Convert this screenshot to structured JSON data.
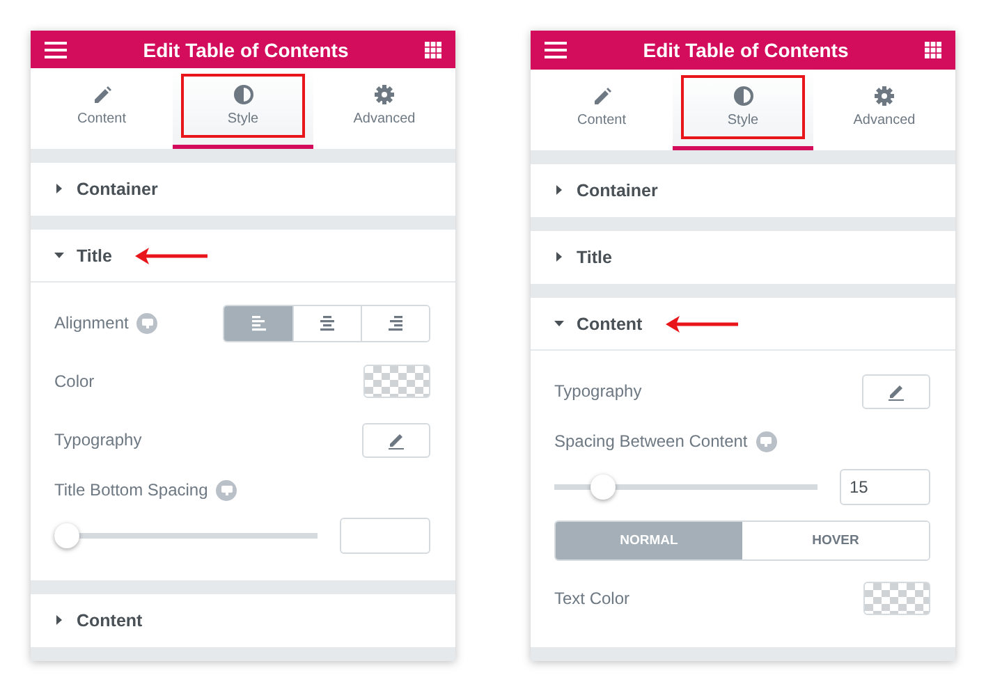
{
  "panels": [
    {
      "header": {
        "title": "Edit Table of Contents"
      },
      "tabs": [
        {
          "label": "Content",
          "selected": false,
          "highlighted": false
        },
        {
          "label": "Style",
          "selected": true,
          "highlighted": true
        },
        {
          "label": "Advanced",
          "selected": false,
          "highlighted": false
        }
      ],
      "sections": [
        {
          "title": "Container",
          "expanded": false,
          "pointed": false
        },
        {
          "title": "Title",
          "expanded": true,
          "pointed": true,
          "controls": [
            {
              "kind": "alignment",
              "label": "Alignment",
              "responsive": true,
              "options": [
                {
                  "selected": true
                },
                {
                  "selected": false
                },
                {
                  "selected": false
                }
              ]
            },
            {
              "kind": "color",
              "label": "Color"
            },
            {
              "kind": "typography",
              "label": "Typography"
            },
            {
              "kind": "slider",
              "label": "Title Bottom Spacing",
              "responsive": true,
              "level": 0
            }
          ]
        },
        {
          "title": "Content",
          "expanded": false,
          "pointed": false
        }
      ]
    },
    {
      "header": {
        "title": "Edit Table of Contents"
      },
      "tabs": [
        {
          "label": "Content",
          "selected": false,
          "highlighted": false
        },
        {
          "label": "Style",
          "selected": true,
          "highlighted": true
        },
        {
          "label": "Advanced",
          "selected": false,
          "highlighted": false
        }
      ],
      "sections": [
        {
          "title": "Container",
          "expanded": false,
          "pointed": false
        },
        {
          "title": "Title",
          "expanded": false,
          "pointed": false
        },
        {
          "title": "Content",
          "expanded": true,
          "pointed": true,
          "controls": [
            {
              "kind": "typography",
              "label": "Typography"
            },
            {
              "kind": "slider",
              "label": "Spacing Between Content",
              "responsive": true,
              "level": 0.15,
              "value": "15"
            },
            {
              "kind": "toggle",
              "options": [
                {
                  "label": "NORMAL",
                  "selected": true
                },
                {
                  "label": "HOVER",
                  "selected": false
                }
              ]
            },
            {
              "kind": "color",
              "label": "Text Color"
            }
          ]
        }
      ]
    }
  ]
}
